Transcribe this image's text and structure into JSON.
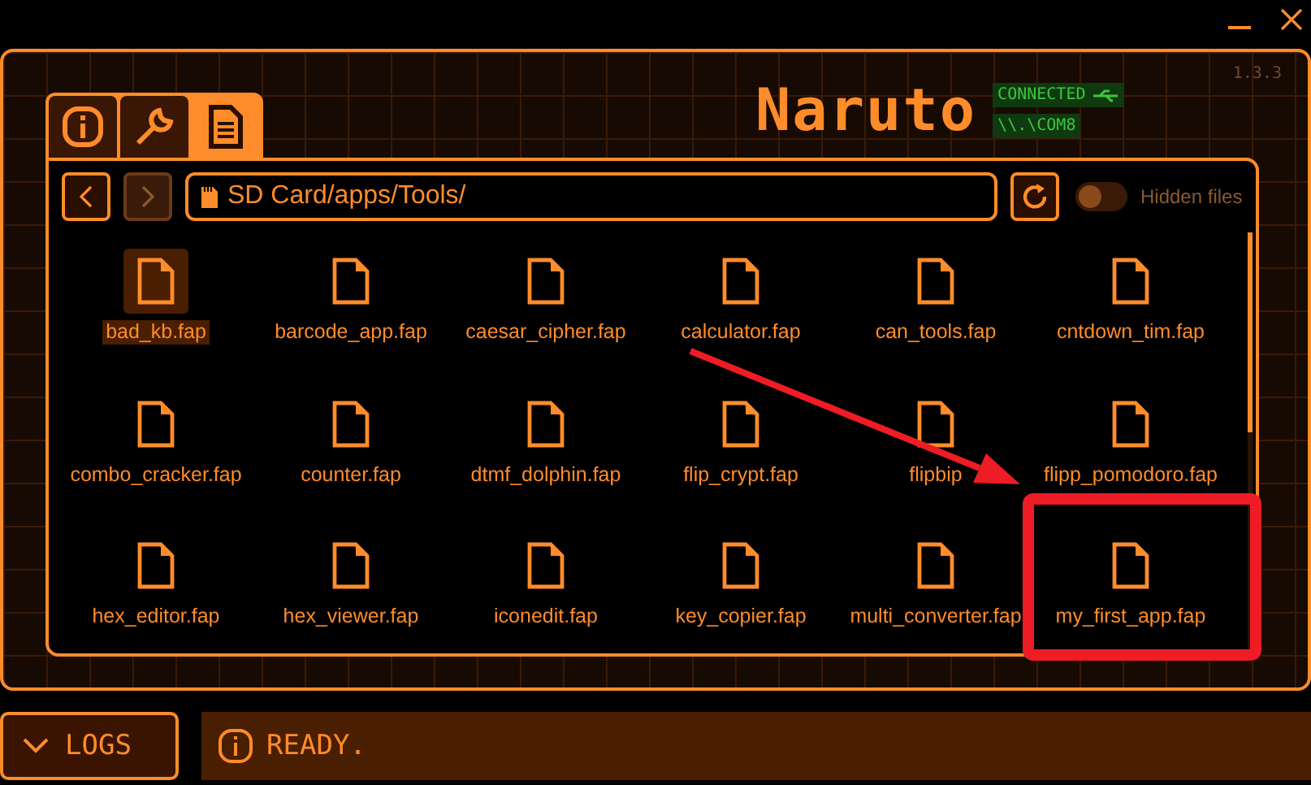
{
  "version": "1.3.3",
  "tabs": [
    {
      "kind": "info",
      "selected": false
    },
    {
      "kind": "tools",
      "selected": false
    },
    {
      "kind": "files",
      "selected": true
    }
  ],
  "logo": "Naruto",
  "connection": {
    "status": "CONNECTED",
    "port": "\\\\.\\COM8"
  },
  "nav": [
    {
      "kind": "back",
      "disabled": false
    },
    {
      "kind": "forward",
      "disabled": true
    }
  ],
  "path": "SD Card/apps/Tools/",
  "hidden_files": {
    "label": "Hidden files",
    "on": false
  },
  "files": [
    {
      "name": "bad_kb.fap",
      "selected": true
    },
    {
      "name": "barcode_app.fap",
      "selected": false
    },
    {
      "name": "caesar_cipher.fap",
      "selected": false
    },
    {
      "name": "calculator.fap",
      "selected": false
    },
    {
      "name": "can_tools.fap",
      "selected": false
    },
    {
      "name": "cntdown_tim.fap",
      "selected": false
    },
    {
      "name": "combo_cracker.fap",
      "selected": false
    },
    {
      "name": "counter.fap",
      "selected": false
    },
    {
      "name": "dtmf_dolphin.fap",
      "selected": false
    },
    {
      "name": "flip_crypt.fap",
      "selected": false
    },
    {
      "name": "flipbip",
      "selected": false
    },
    {
      "name": "flipp_pomodoro.fap",
      "selected": false
    },
    {
      "name": "hex_editor.fap",
      "selected": false
    },
    {
      "name": "hex_viewer.fap",
      "selected": false
    },
    {
      "name": "iconedit.fap",
      "selected": false
    },
    {
      "name": "key_copier.fap",
      "selected": false
    },
    {
      "name": "multi_converter.fap",
      "selected": false
    },
    {
      "name": "my_first_app.fap",
      "selected": false
    }
  ],
  "logs_button": "LOGS",
  "status": "READY."
}
